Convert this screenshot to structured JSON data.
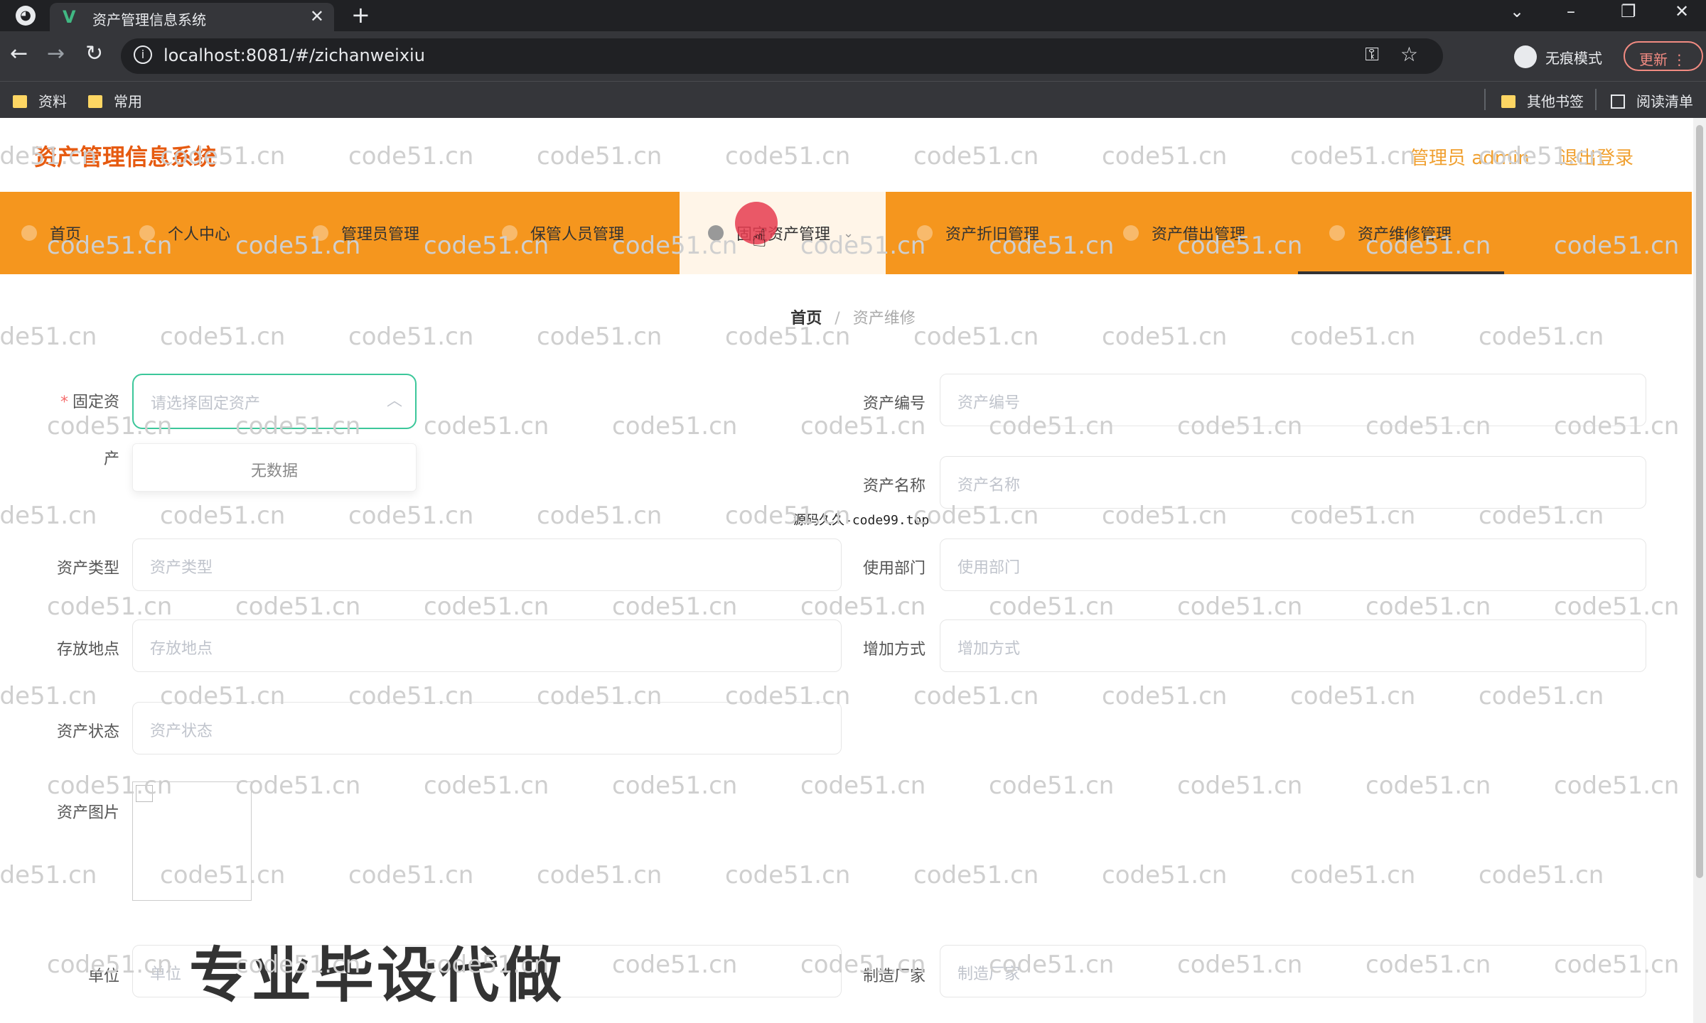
{
  "browser": {
    "tab_title": "资产管理信息系统",
    "favicon": "V",
    "url": "localhost:8081/#/zichanweixiu",
    "incognito_label": "无痕模式",
    "update_label": "更新",
    "bookmarks": [
      "资料",
      "常用"
    ],
    "other_bookmarks": "其他书签",
    "reading_list": "阅读清单"
  },
  "header": {
    "title": "资产管理信息系统",
    "user": "管理员 admin",
    "logout": "退出登录"
  },
  "nav": {
    "items": [
      {
        "label": "首页"
      },
      {
        "label": "个人中心"
      },
      {
        "label": "管理员管理"
      },
      {
        "label": "保管人员管理"
      },
      {
        "label": "固定资产管理"
      },
      {
        "label": "资产折旧管理"
      },
      {
        "label": "资产借出管理"
      },
      {
        "label": "资产维修管理"
      }
    ]
  },
  "breadcrumb": {
    "home": "首页",
    "current": "资产维修"
  },
  "form": {
    "fixed_asset": {
      "label_line1": "固定资",
      "label_line2": "产",
      "placeholder": "请选择固定资产",
      "dropdown_empty": "无数据"
    },
    "asset_no": {
      "label": "资产编号",
      "placeholder": "资产编号"
    },
    "asset_name": {
      "label": "资产名称",
      "placeholder": "资产名称"
    },
    "asset_type": {
      "label": "资产类型",
      "placeholder": "资产类型"
    },
    "department": {
      "label": "使用部门",
      "placeholder": "使用部门"
    },
    "location": {
      "label": "存放地点",
      "placeholder": "存放地点"
    },
    "add_method": {
      "label": "增加方式",
      "placeholder": "增加方式"
    },
    "status": {
      "label": "资产状态",
      "placeholder": "资产状态"
    },
    "image": {
      "label": "资产图片"
    },
    "unit": {
      "label": "单位",
      "placeholder": "单位"
    },
    "manufacturer": {
      "label": "制造厂家",
      "placeholder": "制造厂家"
    }
  },
  "overlay": {
    "banner": "专业毕设代做",
    "source": "源码久久-code99.top"
  },
  "watermark": "code51.cn",
  "colors": {
    "nav_bg": "#f5961e",
    "title": "#e65a10",
    "accent": "#3cc79a"
  }
}
